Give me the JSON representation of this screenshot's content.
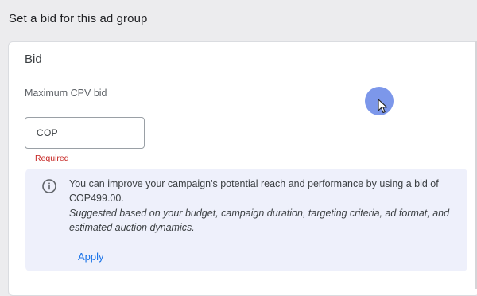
{
  "page": {
    "heading": "Set a bid for this ad group"
  },
  "bid_card": {
    "title": "Bid",
    "field_label": "Maximum CPV bid",
    "input": {
      "currency_prefix": "COP",
      "value": "",
      "placeholder": ""
    },
    "error": "Required",
    "suggestion": {
      "icon": "info-icon",
      "message": "You can improve your campaign's potential reach and performance by using a bid of COP499.00.",
      "detail": "Suggested based on your budget, campaign duration, targeting criteria, ad format, and estimated auction dynamics.",
      "apply_label": "Apply"
    }
  },
  "colors": {
    "accent": "#1a73e8",
    "error": "#c5221f",
    "suggestion_bg": "#eef0fb",
    "cursor_highlight": "#6585e6"
  }
}
